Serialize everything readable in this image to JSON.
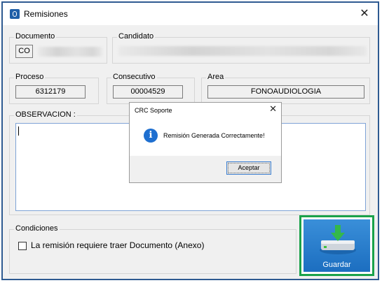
{
  "window": {
    "title": "Remisiones"
  },
  "documento": {
    "label": "Documento",
    "type": "CO"
  },
  "candidato": {
    "label": "Candidato"
  },
  "proceso": {
    "label": "Proceso",
    "value": "6312179"
  },
  "consecutivo": {
    "label": "Consecutivo",
    "value": "00004529"
  },
  "area": {
    "label": "Area",
    "value": "FONOAUDIOLOGIA"
  },
  "observacion": {
    "label": "OBSERVACION :",
    "value": ""
  },
  "condiciones": {
    "label": "Condiciones",
    "checkbox_label": "La remisión requiere traer Documento (Anexo)",
    "checked": false
  },
  "save_button": {
    "label": "Guardar"
  },
  "dialog": {
    "title": "CRC Soporte",
    "message": "Remisión Generada Correctamente!",
    "ok_label": "Aceptar"
  },
  "colors": {
    "accent": "#2e5a91",
    "save_highlight": "#1aa24a",
    "save_button_bg": "#1c6ec0",
    "info_icon": "#1e6fd0"
  },
  "icons": [
    "app-icon",
    "close-icon",
    "info-icon",
    "save-drive-icon"
  ]
}
